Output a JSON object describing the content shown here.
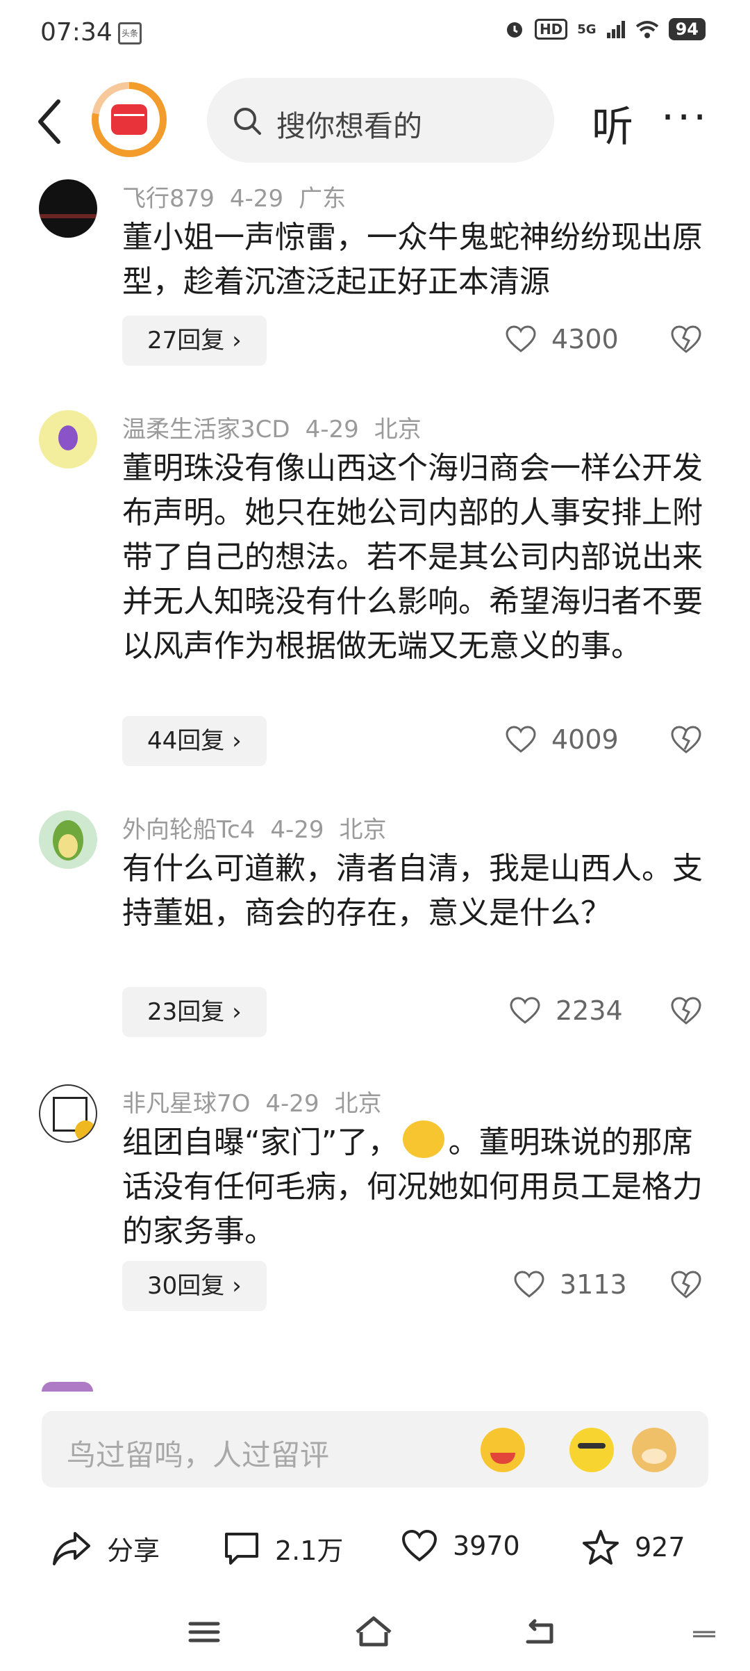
{
  "status_bar": {
    "time": "07:34",
    "app_badge": "头条",
    "hd": "HD",
    "network": "5G",
    "battery": "94"
  },
  "header": {
    "search_placeholder": "搜你想看的",
    "listen_label": "听",
    "more_label": "···"
  },
  "comments": [
    {
      "user": "飞行879",
      "date": "4-29",
      "location": "广东",
      "text": "董小姐一声惊雷，一众牛鬼蛇神纷纷现出原型，趁着沉渣泛起正好正本清源",
      "replies": "27回复",
      "likes": "4300"
    },
    {
      "user": "温柔生活家3CD",
      "date": "4-29",
      "location": "北京",
      "text": "董明珠没有像山西这个海归商会一样公开发布声明。她只在她公司内部的人事安排上附带了自己的想法。若不是其公司内部说出来并无人知晓没有什么影响。希望海归者不要以风声作为根据做无端又无意义的事。",
      "replies": "44回复",
      "likes": "4009"
    },
    {
      "user": "外向轮船Tc4",
      "date": "4-29",
      "location": "北京",
      "text": "有什么可道歉，清者自清，我是山西人。支持董姐，商会的存在，意义是什么？",
      "replies": "23回复",
      "likes": "2234"
    },
    {
      "user": "非凡星球7O",
      "date": "4-29",
      "location": "北京",
      "text_before": "组团自曝“家门”了，",
      "text_after": "。董明珠说的那席话没有任何毛病，何况她如何用员工是格力的家务事。",
      "replies": "30回复",
      "likes": "3113"
    }
  ],
  "reply_input": {
    "placeholder": "鸟过留鸣，人过留评"
  },
  "actions": {
    "share": "分享",
    "comments": "2.1万",
    "likes": "3970",
    "favorites": "927"
  }
}
